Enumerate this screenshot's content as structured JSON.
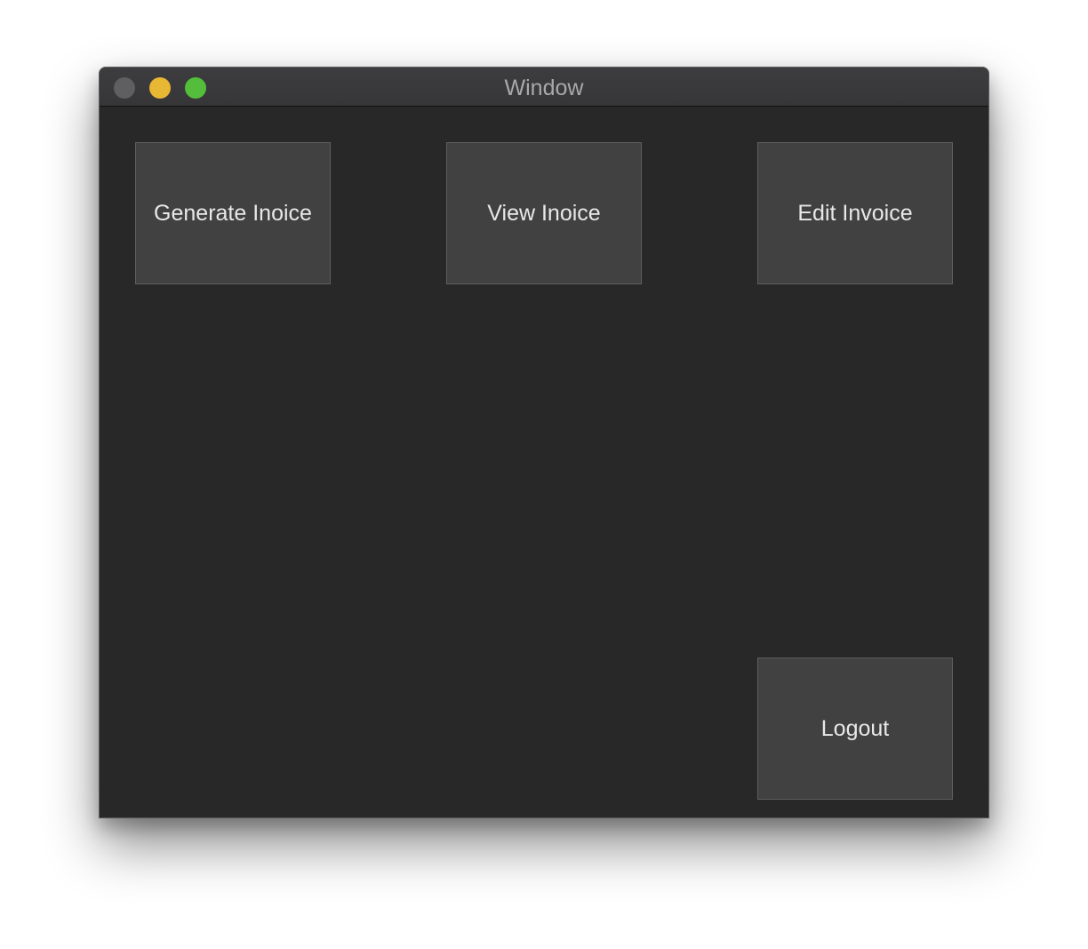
{
  "window": {
    "title": "Window"
  },
  "buttons": {
    "generate_invoice": "Generate Inoice",
    "view_invoice": "View Inoice",
    "edit_invoice": "Edit Invoice",
    "logout": "Logout"
  },
  "colors": {
    "background": "#282828",
    "button": "#414141",
    "text": "#e8e8e8",
    "close": "#5f5f61",
    "minimize": "#e8b734",
    "zoom": "#54be3c"
  }
}
